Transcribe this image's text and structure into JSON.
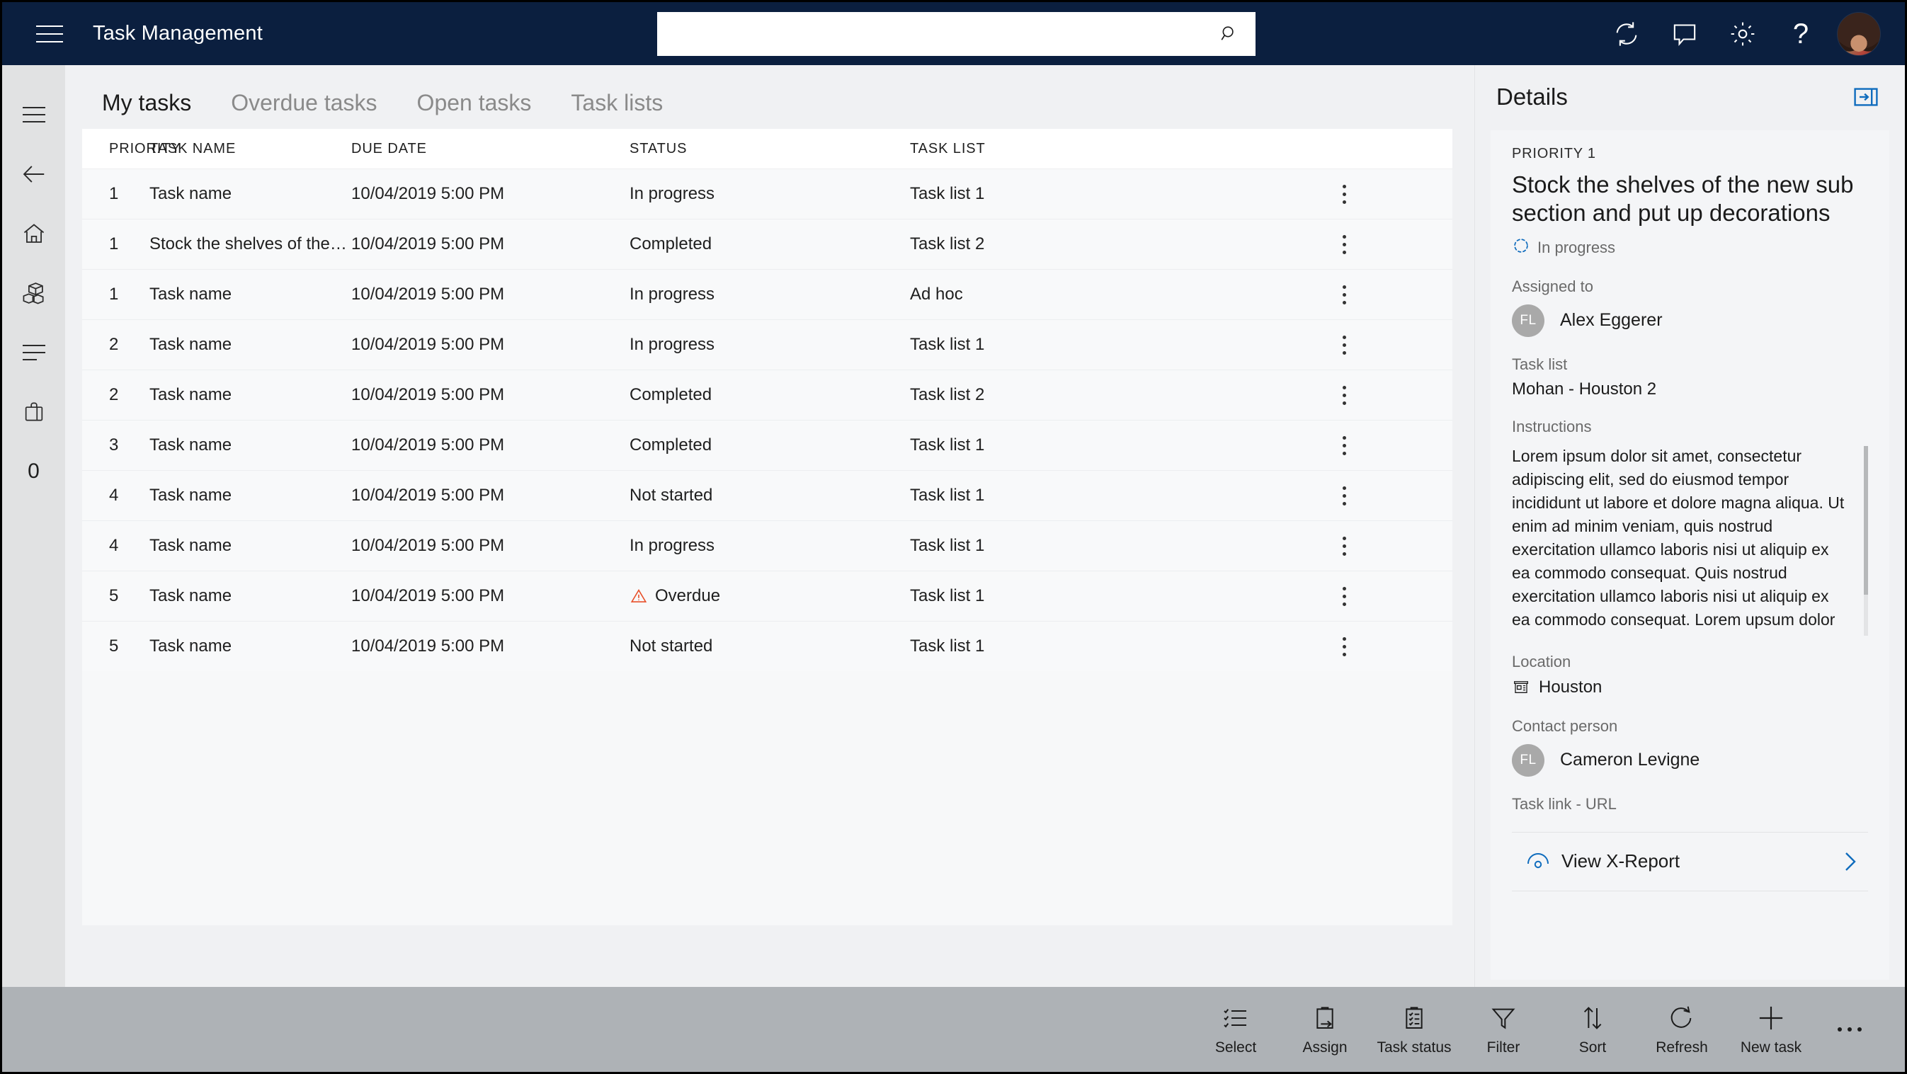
{
  "topnav": {
    "menu_icon": "hamburger-icon",
    "title": "Task Management",
    "search": {
      "value": "",
      "placeholder": "",
      "icon": "search-icon"
    },
    "actions": [
      {
        "name": "refresh-icon",
        "label": "Refresh"
      },
      {
        "name": "feedback-icon",
        "label": "Feedback"
      },
      {
        "name": "settings-gear-icon",
        "label": "Settings"
      },
      {
        "name": "help-icon",
        "label": "?"
      }
    ],
    "avatar_alt": "user-avatar"
  },
  "rail": {
    "items": [
      {
        "name": "rail-hamburger-icon",
        "label": "Menu"
      },
      {
        "name": "rail-back-arrow-icon",
        "label": "Back"
      },
      {
        "name": "rail-home-icon",
        "label": "Home"
      },
      {
        "name": "rail-products-icon",
        "label": "Products"
      },
      {
        "name": "rail-list-icon",
        "label": "Lists"
      },
      {
        "name": "rail-bag-icon",
        "label": "Bag"
      },
      {
        "name": "rail-count-badge",
        "label": "0"
      }
    ]
  },
  "tabs": [
    {
      "label": "My tasks",
      "active": true
    },
    {
      "label": "Overdue tasks",
      "active": false
    },
    {
      "label": "Open tasks",
      "active": false
    },
    {
      "label": "Task lists",
      "active": false
    }
  ],
  "table": {
    "columns": [
      "PRIORITY",
      "TASK NAME",
      "DUE DATE",
      "STATUS",
      "TASK LIST"
    ],
    "rows": [
      {
        "priority": "1",
        "name": "Task name",
        "due": "10/04/2019 5:00 PM",
        "status": "In progress",
        "overdue": false,
        "list": "Task list 1"
      },
      {
        "priority": "1",
        "name": "Stock the shelves of the new sub section...",
        "due": "10/04/2019 5:00 PM",
        "status": "Completed",
        "overdue": false,
        "list": "Task list 2"
      },
      {
        "priority": "1",
        "name": "Task name",
        "due": "10/04/2019 5:00 PM",
        "status": "In progress",
        "overdue": false,
        "list": "Ad hoc"
      },
      {
        "priority": "2",
        "name": "Task name",
        "due": "10/04/2019 5:00 PM",
        "status": "In progress",
        "overdue": false,
        "list": "Task list 1"
      },
      {
        "priority": "2",
        "name": "Task name",
        "due": "10/04/2019 5:00 PM",
        "status": "Completed",
        "overdue": false,
        "list": "Task list 2"
      },
      {
        "priority": "3",
        "name": "Task name",
        "due": "10/04/2019 5:00 PM",
        "status": "Completed",
        "overdue": false,
        "list": "Task list 1"
      },
      {
        "priority": "4",
        "name": "Task name",
        "due": "10/04/2019 5:00 PM",
        "status": "Not started",
        "overdue": false,
        "list": "Task list 1"
      },
      {
        "priority": "4",
        "name": "Task name",
        "due": "10/04/2019 5:00 PM",
        "status": "In progress",
        "overdue": false,
        "list": "Task list 1"
      },
      {
        "priority": "5",
        "name": "Task name",
        "due": "10/04/2019 5:00 PM",
        "status": "Overdue",
        "overdue": true,
        "list": "Task list 1"
      },
      {
        "priority": "5",
        "name": "Task name",
        "due": "10/04/2019 5:00 PM",
        "status": "Not started",
        "overdue": false,
        "list": "Task list 1"
      }
    ]
  },
  "details": {
    "title": "Details",
    "collapse_icon": "collapse-panel-icon",
    "priority": "PRIORITY 1",
    "task_title": "Stock the shelves of the new sub section and put up decorations",
    "status": "In progress",
    "status_icon": "in-progress-spinner-icon",
    "assigned_label": "Assigned to",
    "assigned_initials": "FL",
    "assigned_name": "Alex Eggerer",
    "tasklist_label": "Task list",
    "tasklist_value": "Mohan - Houston 2",
    "instructions_label": "Instructions",
    "instructions": "Lorem ipsum dolor sit amet, consectetur adipiscing elit, sed do eiusmod tempor incididunt ut labore et dolore magna aliqua. Ut enim ad minim veniam, quis nostrud exercitation ullamco laboris nisi ut aliquip ex ea commodo consequat. Quis nostrud exercitation ullamco laboris nisi ut aliquip ex ea commodo consequat. Lorem upsum dolor sit amet, consectetur Quis nostrud exercitation ullamco laboris nisi ut",
    "location_label": "Location",
    "location_value": "Houston",
    "location_icon": "store-icon",
    "contact_label": "Contact person",
    "contact_initials": "FL",
    "contact_name": "Cameron Levigne",
    "link_label": "Task link - URL",
    "link_text": "View X-Report",
    "link_icon": "visibility-eye-icon",
    "link_chevron": "chevron-right-icon"
  },
  "commandbar": {
    "buttons": [
      {
        "label": "Select",
        "icon": "select-list-icon"
      },
      {
        "label": "Assign",
        "icon": "assign-clipboard-icon"
      },
      {
        "label": "Task status",
        "icon": "task-status-clipboard-icon"
      },
      {
        "label": "Filter",
        "icon": "filter-funnel-icon"
      },
      {
        "label": "Sort",
        "icon": "sort-arrows-icon"
      },
      {
        "label": "Refresh",
        "icon": "refresh-circular-icon"
      },
      {
        "label": "New task",
        "icon": "plus-icon"
      }
    ],
    "overflow_icon": "more-ellipsis-icon"
  },
  "colors": {
    "nav_bg": "#0b1f3f",
    "accent_blue": "#0f6cbd",
    "overdue_red": "#e8502a",
    "cmdbar_bg": "#aeb2b6",
    "rail_bg": "#e1e2e3"
  }
}
